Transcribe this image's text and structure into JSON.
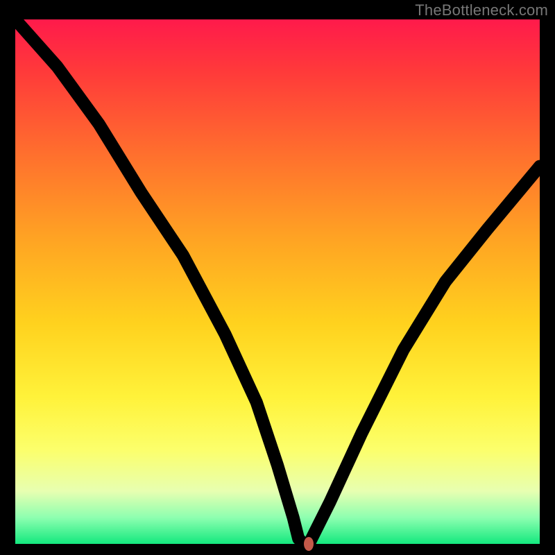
{
  "watermark": {
    "text": "TheBottleneck.com"
  },
  "chart_data": {
    "type": "line",
    "title": "",
    "xlabel": "",
    "ylabel": "",
    "xlim": [
      0,
      100
    ],
    "ylim": [
      0,
      100
    ],
    "grid": false,
    "legend": false,
    "series": [
      {
        "name": "bottleneck-curve",
        "x": [
          0,
          8,
          16,
          24,
          32,
          40,
          46,
          50,
          53,
          54,
          55,
          56,
          60,
          66,
          74,
          82,
          90,
          100
        ],
        "values": [
          100,
          91,
          80,
          67,
          55,
          40,
          27,
          15,
          5,
          1,
          0,
          0,
          8,
          21,
          37,
          50,
          60,
          72
        ]
      }
    ],
    "marker": {
      "x": 56,
      "y": 0,
      "color": "#c45a4a"
    },
    "background_gradient": {
      "direction": "vertical",
      "stops": [
        {
          "pos": 0.0,
          "color": "#ff1a4b"
        },
        {
          "pos": 0.1,
          "color": "#ff3a3a"
        },
        {
          "pos": 0.25,
          "color": "#ff6d2e"
        },
        {
          "pos": 0.42,
          "color": "#ffa423"
        },
        {
          "pos": 0.58,
          "color": "#ffd21e"
        },
        {
          "pos": 0.72,
          "color": "#fff23a"
        },
        {
          "pos": 0.82,
          "color": "#fcff6b"
        },
        {
          "pos": 0.9,
          "color": "#e7ffb1"
        },
        {
          "pos": 0.95,
          "color": "#8dffb0"
        },
        {
          "pos": 1.0,
          "color": "#13e87e"
        }
      ]
    }
  }
}
